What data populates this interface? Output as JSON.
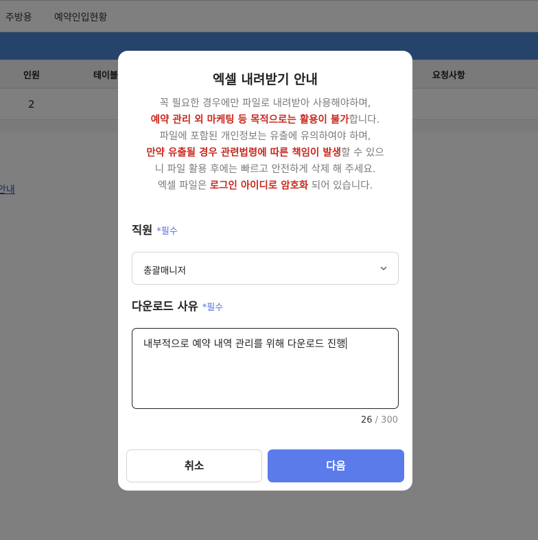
{
  "background": {
    "tabs": [
      "주방용",
      "예약인입현황"
    ],
    "table_headers": [
      "인원",
      "테이블",
      "요청사항"
    ],
    "row_value": "2",
    "link_text": "안내"
  },
  "modal": {
    "title": "엑셀 내려받기 안내",
    "notice": {
      "l1": "꼭 필요한 경우에만 파일로 내려받아 사용해야하며,",
      "l2_em": "예약 관리 외 마케팅 등 목적으로는 활용이 불가",
      "l2_rest": "합니다.",
      "l3": "파일에 포함된 개인정보는 유출에 유의하여야 하며,",
      "l4_em": "만약 유출될 경우 관련법령에 따른 책임이 발생",
      "l4_rest": "할 수 있으",
      "l5": "니 파일 활용 후에는 빠르고 안전하게 삭제 해 주세요.",
      "l6_pre": "엑셀 파일은 ",
      "l6_em": "로그인 아이디로 암호화",
      "l6_post": " 되어 있습니다."
    },
    "staff_label": "직원",
    "staff_required": "*필수",
    "staff_value": "총괄매니저",
    "reason_label": "다운로드 사유",
    "reason_required": "*필수",
    "reason_value": "내부적으로 예약 내역 관리를 위해 다운로드 진행",
    "counter_current": "26",
    "counter_sep": " / ",
    "counter_max": "300",
    "cancel_label": "취소",
    "next_label": "다음"
  },
  "colors": {
    "accent": "#5b7bea",
    "warning": "#c8281e",
    "required": "#4f6fe0",
    "header_bar": "#4c86d6"
  }
}
